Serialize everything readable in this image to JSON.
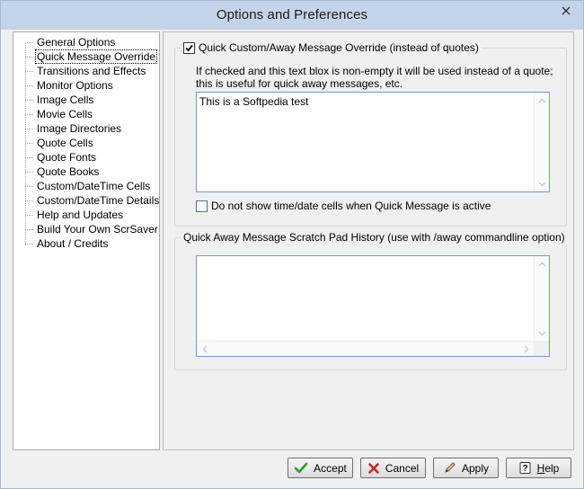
{
  "window": {
    "title": "Options and Preferences"
  },
  "tree": {
    "items": [
      {
        "label": "General Options",
        "selected": false
      },
      {
        "label": "Quick Message Override",
        "selected": true
      },
      {
        "label": "Transitions and Effects",
        "selected": false
      },
      {
        "label": "Monitor Options",
        "selected": false
      },
      {
        "label": "Image Cells",
        "selected": false
      },
      {
        "label": "Movie Cells",
        "selected": false
      },
      {
        "label": "Image Directories",
        "selected": false
      },
      {
        "label": "Quote Cells",
        "selected": false
      },
      {
        "label": "Quote Fonts",
        "selected": false
      },
      {
        "label": "Quote Books",
        "selected": false
      },
      {
        "label": "Custom/DateTime Cells",
        "selected": false
      },
      {
        "label": "Custom/DateTime Details",
        "selected": false
      },
      {
        "label": "Help and Updates",
        "selected": false
      },
      {
        "label": "Build Your Own ScrSaver",
        "selected": false
      },
      {
        "label": "About / Credits",
        "selected": false
      }
    ]
  },
  "quick_message": {
    "checkbox_label": "Quick Custom/Away Message Override (instead of quotes)",
    "checked": true,
    "description": "If checked and this text blox is non-empty it will be used instead of a quote; this is useful for quick away messages, etc.",
    "text_value": "This is a Softpedia test",
    "no_time_label": "Do not show time/date cells when Quick Message is active",
    "no_time_checked": false
  },
  "scratch_pad": {
    "title": "Quick Away Message Scratch Pad History (use with /away commandline option)",
    "text_value": ""
  },
  "buttons": {
    "accept": "Accept",
    "cancel": "Cancel",
    "apply": "Apply",
    "help_underlined": "H",
    "help_rest": "elp"
  },
  "colors": {
    "accept_icon": "#2e9b2e",
    "cancel_icon": "#d42020",
    "titlebar": "#c4d4e8"
  }
}
